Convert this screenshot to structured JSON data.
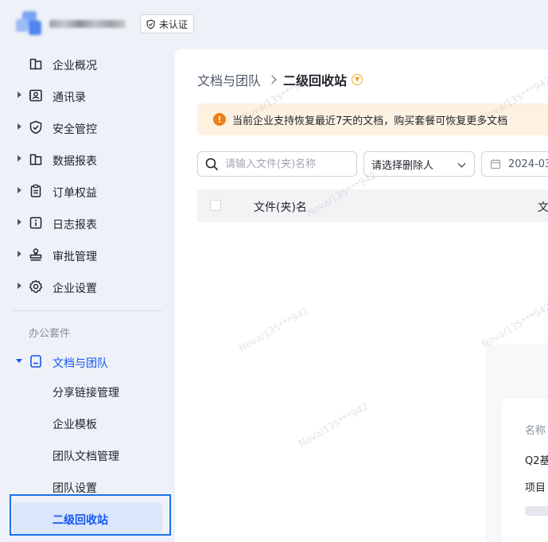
{
  "header": {
    "badge_label": "未认证"
  },
  "sidebar": {
    "items": [
      {
        "label": "企业概况",
        "icon": "building-icon",
        "expandable": false
      },
      {
        "label": "通讯录",
        "icon": "contacts-icon",
        "expandable": true
      },
      {
        "label": "安全管控",
        "icon": "shield-check-icon",
        "expandable": true
      },
      {
        "label": "数据报表",
        "icon": "building-icon",
        "expandable": true
      },
      {
        "label": "订单权益",
        "icon": "clipboard-icon",
        "expandable": true
      },
      {
        "label": "日志报表",
        "icon": "info-box-icon",
        "expandable": true
      },
      {
        "label": "审批管理",
        "icon": "stamp-icon",
        "expandable": true
      },
      {
        "label": "企业设置",
        "icon": "gear-icon",
        "expandable": true
      }
    ],
    "section_label": "办公套件",
    "docs_group": {
      "label": "文档与团队",
      "children": [
        "分享链接管理",
        "企业模板",
        "团队文档管理",
        "团队设置",
        "二级回收站"
      ]
    }
  },
  "main": {
    "breadcrumb_parent": "文档与团队",
    "breadcrumb_current": "二级回收站",
    "notice": "当前企业支持恢复最近7天的文档，购买套餐可恢复更多文档",
    "search_placeholder": "请输入文件(夹)名称",
    "deleter_select": "请选择删除人",
    "date_value": "2024-03",
    "table_headers": [
      "文件(夹)名",
      "文"
    ],
    "card": {
      "label_name": "名称",
      "value_1": "Q2基",
      "value_2": "项目"
    },
    "watermark": "Nova/135***942"
  },
  "colors": {
    "accent": "#1456f0",
    "notice_bg": "#fdf1e2",
    "warn": "#f07f1a",
    "selected_bg": "#dbe5fb"
  }
}
